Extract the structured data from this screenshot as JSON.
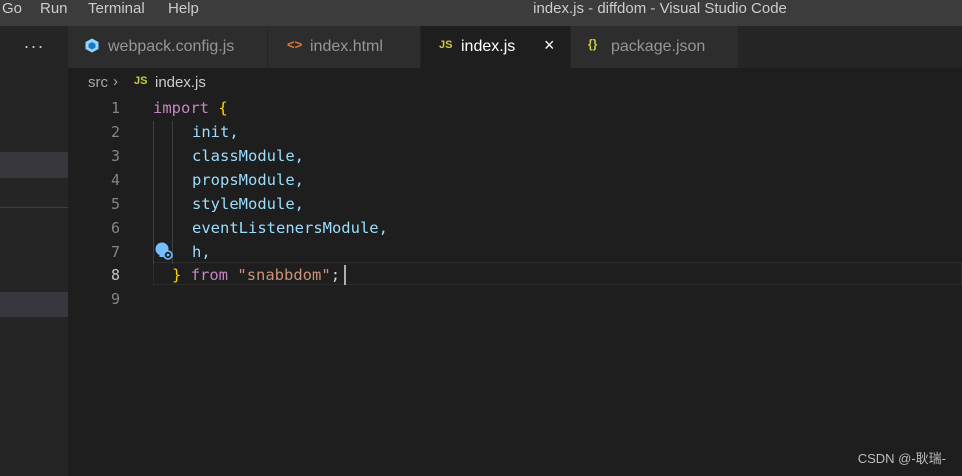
{
  "menu": {
    "items": [
      "Go",
      "Run",
      "Terminal",
      "Help"
    ]
  },
  "window": {
    "title": "index.js - diffdom - Visual Studio Code"
  },
  "sidebar": {
    "more_label": "···"
  },
  "tabs": [
    {
      "label": "webpack.config.js",
      "icon": "webpack-icon",
      "active": false
    },
    {
      "label": "index.html",
      "icon": "html-icon",
      "active": false
    },
    {
      "label": "index.js",
      "icon": "js-icon",
      "active": true
    },
    {
      "label": "package.json",
      "icon": "json-icon",
      "active": false
    }
  ],
  "tab_icons": {
    "html": "<>",
    "js": "JS",
    "json": "{}"
  },
  "tab_close": "×",
  "breadcrumb": {
    "folder": "src",
    "separator": "›",
    "file_icon": "JS",
    "file": "index.js"
  },
  "editor": {
    "language": "javascript",
    "current_line": 8,
    "line_numbers": [
      "1",
      "2",
      "3",
      "4",
      "5",
      "6",
      "7",
      "8",
      "9"
    ],
    "lines": [
      "import {",
      "    init,",
      "    classModule,",
      "    propsModule,",
      "    styleModule,",
      "    eventListenersModule,",
      "    h,",
      "  } from \"snabbdom\";",
      ""
    ],
    "tokens": {
      "import_kw": "import",
      "open_brace": "{",
      "close_brace": "}",
      "from_kw": "from",
      "module_string": "\"snabbdom\"",
      "semicolon": ";",
      "identifiers": [
        "init,",
        "classModule,",
        "propsModule,",
        "styleModule,",
        "eventListenersModule,",
        "h,"
      ]
    }
  },
  "watermark": "CSDN @-耿瑞-",
  "colors": {
    "editor_bg": "#1e1e1e",
    "keyword": "#c586c0",
    "bracket": "#ffd700",
    "string": "#ce9178",
    "variable": "#9cdcfe",
    "line_number": "#858585"
  }
}
